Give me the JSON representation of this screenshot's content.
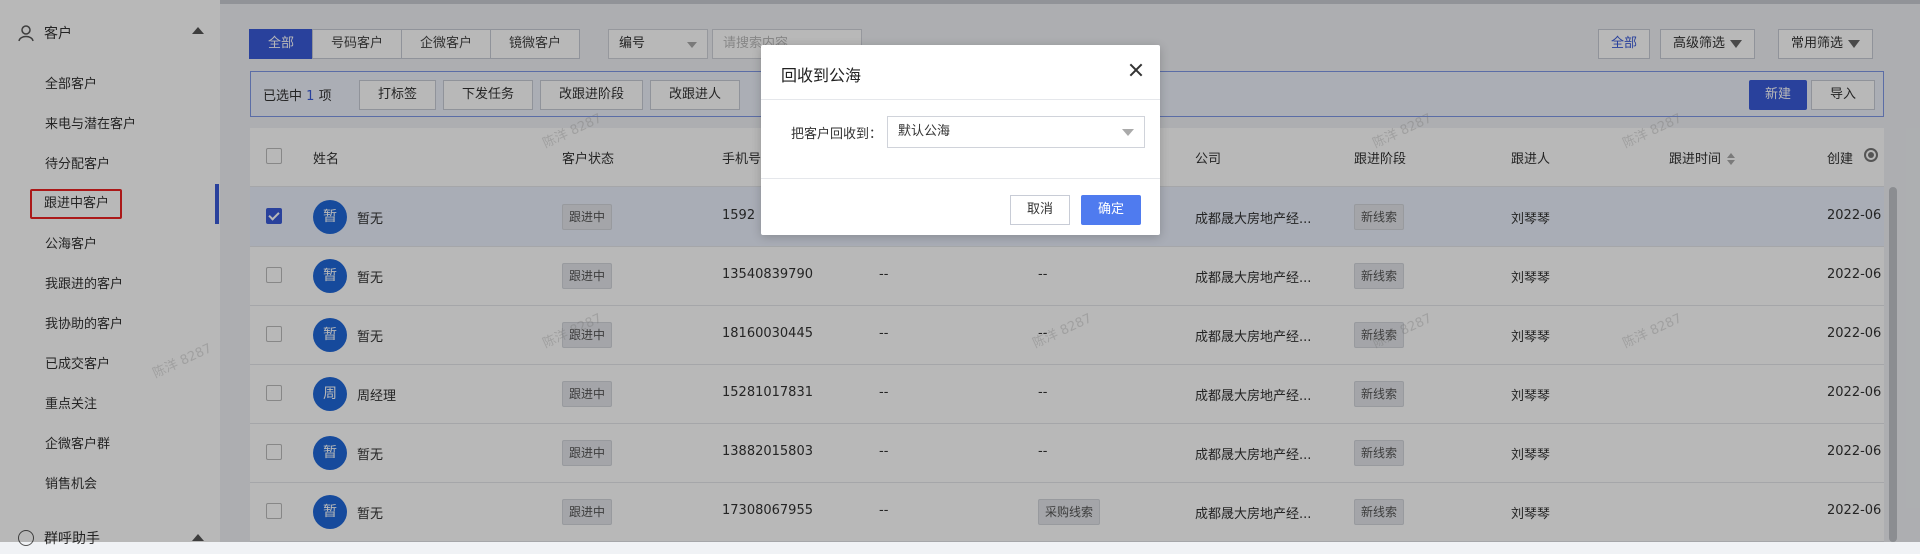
{
  "sidebar": {
    "section_title": "客户",
    "items": [
      {
        "label": "全部客户"
      },
      {
        "label": "来电与潜在客户"
      },
      {
        "label": "待分配客户"
      },
      {
        "label": "跟进中客户"
      },
      {
        "label": "公海客户"
      },
      {
        "label": "我跟进的客户"
      },
      {
        "label": "我协助的客户"
      },
      {
        "label": "已成交客户"
      },
      {
        "label": "重点关注"
      },
      {
        "label": "企微客户群"
      },
      {
        "label": "销售机会"
      }
    ],
    "next_section_title": "群呼助手"
  },
  "tabs": [
    "全部",
    "号码客户",
    "企微客户",
    "镜微客户"
  ],
  "filter_select": {
    "value": "编号"
  },
  "search": {
    "placeholder": "请搜索内容"
  },
  "right_buttons": {
    "all": "全部",
    "advanced_filter": "高级筛选",
    "common_filter": "常用筛选"
  },
  "action_bar": {
    "selected_prefix": "已选中",
    "selected_count": "1",
    "selected_suffix": "项",
    "buttons": [
      "打标签",
      "下发任务",
      "改跟进阶段",
      "改跟进人"
    ],
    "new_label": "新建",
    "import_label": "导入"
  },
  "table": {
    "columns": {
      "name": "姓名",
      "status": "客户状态",
      "phone": "手机号",
      "company": "公司",
      "stage": "跟进阶段",
      "owner": "跟进人",
      "follow_time": "跟进时间",
      "created": "创建"
    },
    "rows": [
      {
        "avatar": "暂",
        "name": "暂无",
        "status": "跟进中",
        "phone": "1592",
        "c5": "",
        "c6": "",
        "company": "成都晟大房地产经...",
        "stage": "新线索",
        "owner": "刘琴琴",
        "created": "2022-06",
        "checked": true
      },
      {
        "avatar": "暂",
        "name": "暂无",
        "status": "跟进中",
        "phone": "13540839790",
        "c5": "--",
        "c6": "--",
        "company": "成都晟大房地产经...",
        "stage": "新线索",
        "owner": "刘琴琴",
        "created": "2022-06",
        "checked": false
      },
      {
        "avatar": "暂",
        "name": "暂无",
        "status": "跟进中",
        "phone": "18160030445",
        "c5": "--",
        "c6": "--",
        "company": "成都晟大房地产经...",
        "stage": "新线索",
        "owner": "刘琴琴",
        "created": "2022-06",
        "checked": false
      },
      {
        "avatar": "周",
        "name": "周经理",
        "status": "跟进中",
        "phone": "15281017831",
        "c5": "--",
        "c6": "--",
        "company": "成都晟大房地产经...",
        "stage": "新线索",
        "owner": "刘琴琴",
        "created": "2022-06",
        "checked": false
      },
      {
        "avatar": "暂",
        "name": "暂无",
        "status": "跟进中",
        "phone": "13882015803",
        "c5": "--",
        "c6": "--",
        "company": "成都晟大房地产经...",
        "stage": "新线索",
        "owner": "刘琴琴",
        "created": "2022-06",
        "checked": false
      },
      {
        "avatar": "暂",
        "name": "暂无",
        "status": "跟进中",
        "phone": "17308067955",
        "c5": "--",
        "c6": "采购线索",
        "company": "成都晟大房地产经...",
        "stage": "新线索",
        "owner": "刘琴琴",
        "created": "2022-06",
        "checked": false
      }
    ]
  },
  "watermark": "陈洋 8287",
  "modal": {
    "title": "回收到公海",
    "field_label": "把客户回收到：",
    "select_value": "默认公海",
    "cancel_label": "取消",
    "ok_label": "确定"
  },
  "colors": {
    "primary": "#3a5bd9",
    "avatar": "#1f67d8",
    "ok_button": "#4f7bef",
    "highlight_border": "#e22222"
  }
}
